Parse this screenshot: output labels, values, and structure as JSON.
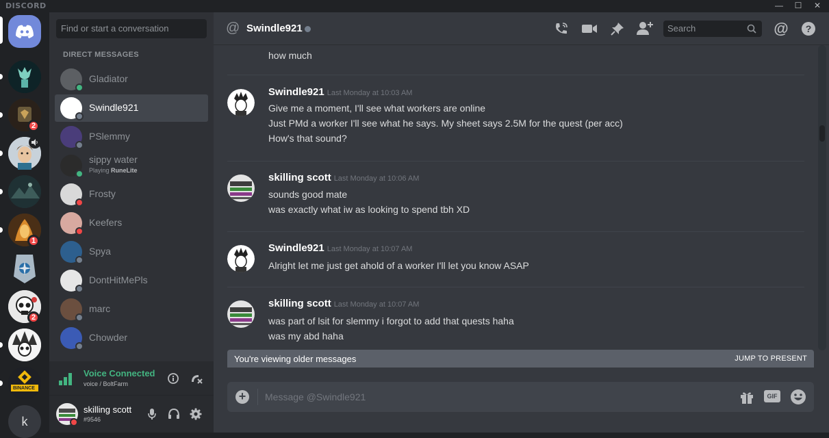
{
  "app": {
    "brand": "DISCORD",
    "win_min": "—",
    "win_max": "☐",
    "win_close": "✕"
  },
  "servers": [
    {
      "name": "server-1",
      "color": "#1a1c1e"
    },
    {
      "name": "server-2",
      "badge": "2"
    },
    {
      "name": "server-3"
    },
    {
      "name": "server-4"
    },
    {
      "name": "server-5",
      "badge": "1"
    },
    {
      "name": "server-6"
    },
    {
      "name": "server-7",
      "badge": "2"
    },
    {
      "name": "server-8"
    },
    {
      "name": "binance",
      "text": "BINANCE"
    },
    {
      "name": "k-server",
      "letter": "k"
    }
  ],
  "sidebar": {
    "search_placeholder": "Find or start a conversation",
    "header": "DIRECT MESSAGES",
    "dms": [
      {
        "name": "Gladiator",
        "status": "online",
        "color": "#5c5f63"
      },
      {
        "name": "Swindle921",
        "status": "offline",
        "color": "#ffffff",
        "selected": true
      },
      {
        "name": "PSlemmy",
        "status": "offline",
        "color": "#4a3d7a"
      },
      {
        "name": "sippy water",
        "status": "online",
        "color": "#2b2b2b",
        "sub_prefix": "Playing",
        "sub_game": "RuneLite"
      },
      {
        "name": "Frosty",
        "status": "dnd",
        "color": "#d9d9d9"
      },
      {
        "name": "Keefers",
        "status": "dnd",
        "color": "#d8a9a0"
      },
      {
        "name": "Spya",
        "status": "offline",
        "color": "#2d5f8e"
      },
      {
        "name": "DontHitMePls",
        "status": "offline",
        "color": "#e6e6e6"
      },
      {
        "name": "marc",
        "status": "offline",
        "color": "#6b4f3f"
      },
      {
        "name": "Chowder",
        "status": "offline",
        "color": "#3b5bb5"
      }
    ],
    "voice": {
      "status": "Voice Connected",
      "channel": "voice / BoltFarm"
    },
    "user": {
      "name": "skilling scott",
      "tag": "#9546"
    }
  },
  "chat": {
    "recipient": "Swindle921",
    "search_placeholder": "Search",
    "partial_line": "how much",
    "messages": [
      {
        "author": "Swindle921",
        "timestamp": "Last Monday at 10:03 AM",
        "lines": [
          "Give me a moment, I'll see what workers are online",
          "Just PMd a worker I'll see what he says. My sheet says 2.5M for the quest (per acc)",
          "How's that sound?"
        ]
      },
      {
        "author": "skilling scott",
        "timestamp": "Last Monday at 10:06 AM",
        "lines": [
          "sounds good mate",
          "was exactly what iw as looking to spend tbh XD"
        ]
      },
      {
        "author": "Swindle921",
        "timestamp": "Last Monday at 10:07 AM",
        "lines": [
          "Alright let me just get ahold of a worker I'll let you know ASAP"
        ]
      },
      {
        "author": "skilling scott",
        "timestamp": "Last Monday at 10:07 AM",
        "lines": [
          "was part of lsit for slemmy i forgot to add that quests haha",
          "was my abd haha"
        ]
      }
    ],
    "older_notice": "You're viewing older messages",
    "jump_label": "JUMP TO PRESENT",
    "input_placeholder": "Message @Swindle921",
    "gif_label": "GIF"
  },
  "colors": {
    "online": "#43b581",
    "dnd": "#f04747",
    "offline": "#747f8d",
    "accent": "#7289da"
  }
}
